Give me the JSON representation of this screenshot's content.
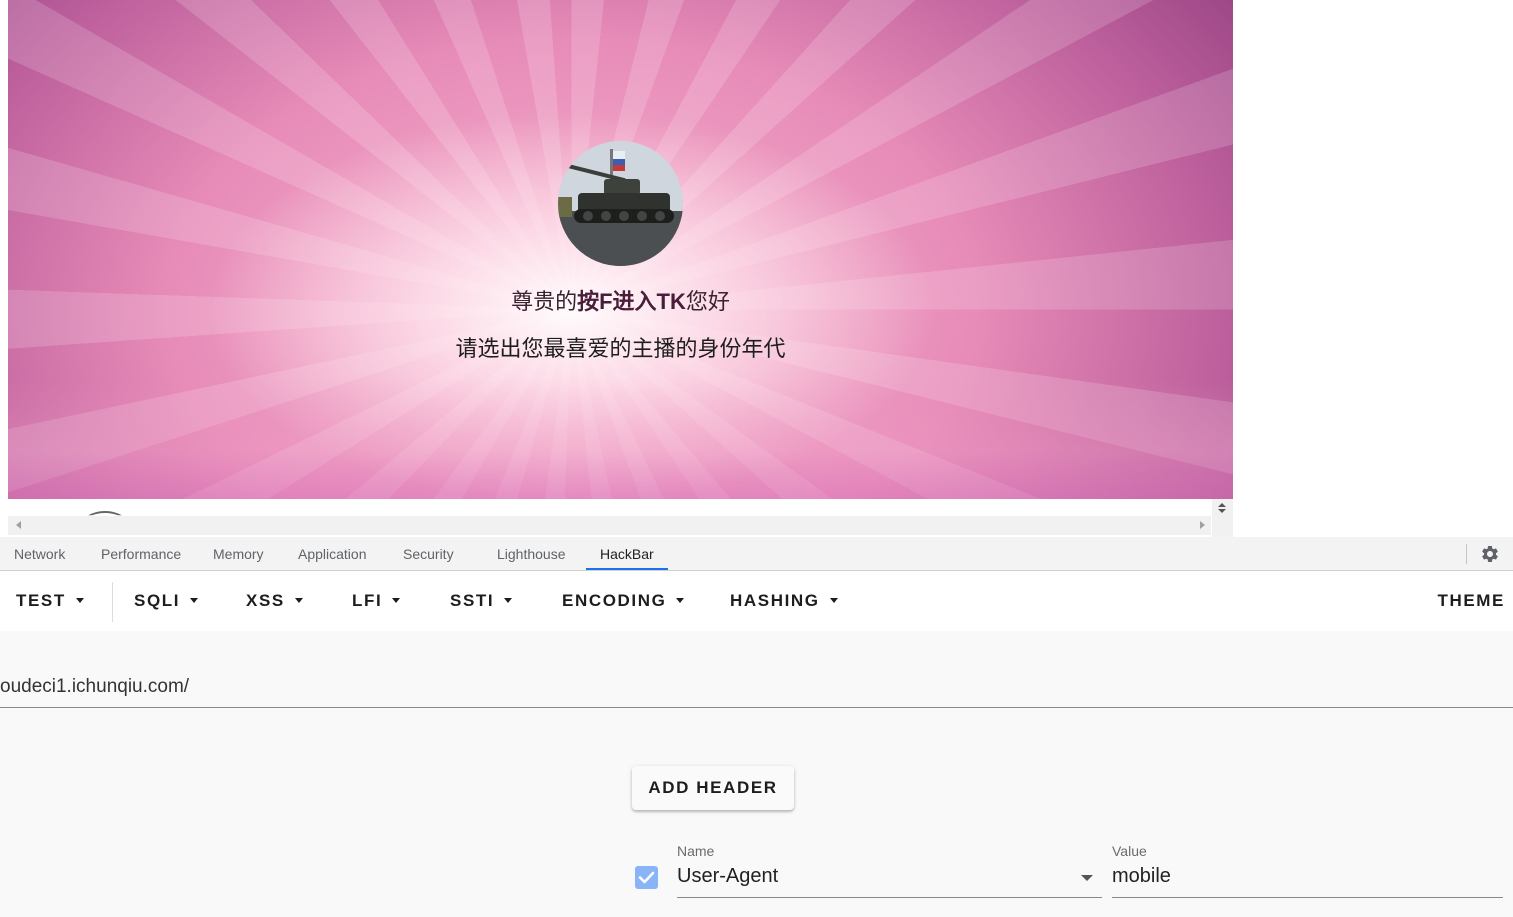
{
  "page": {
    "greeting_prefix": "尊贵的",
    "greeting_name": "按F进入TK",
    "greeting_suffix": "您好",
    "prompt": "请选出您最喜爱的主播的身份年代"
  },
  "devtools": {
    "tabs": [
      "Network",
      "Performance",
      "Memory",
      "Application",
      "Security",
      "Lighthouse",
      "HackBar"
    ],
    "active_tab": "HackBar"
  },
  "hackbar": {
    "menu": [
      "TEST",
      "SQLI",
      "XSS",
      "LFI",
      "SSTI",
      "ENCODING",
      "HASHING"
    ],
    "theme_label": "THEME",
    "url_value": "oudeci1.ichunqiu.com/",
    "add_header_label": "ADD HEADER",
    "header": {
      "enabled": true,
      "name_label": "Name",
      "name_value": "User-Agent",
      "value_label": "Value",
      "value_value": "mobile"
    }
  },
  "colors": {
    "accent": "#1a73e8",
    "checkbox": "#8ab4f8"
  }
}
